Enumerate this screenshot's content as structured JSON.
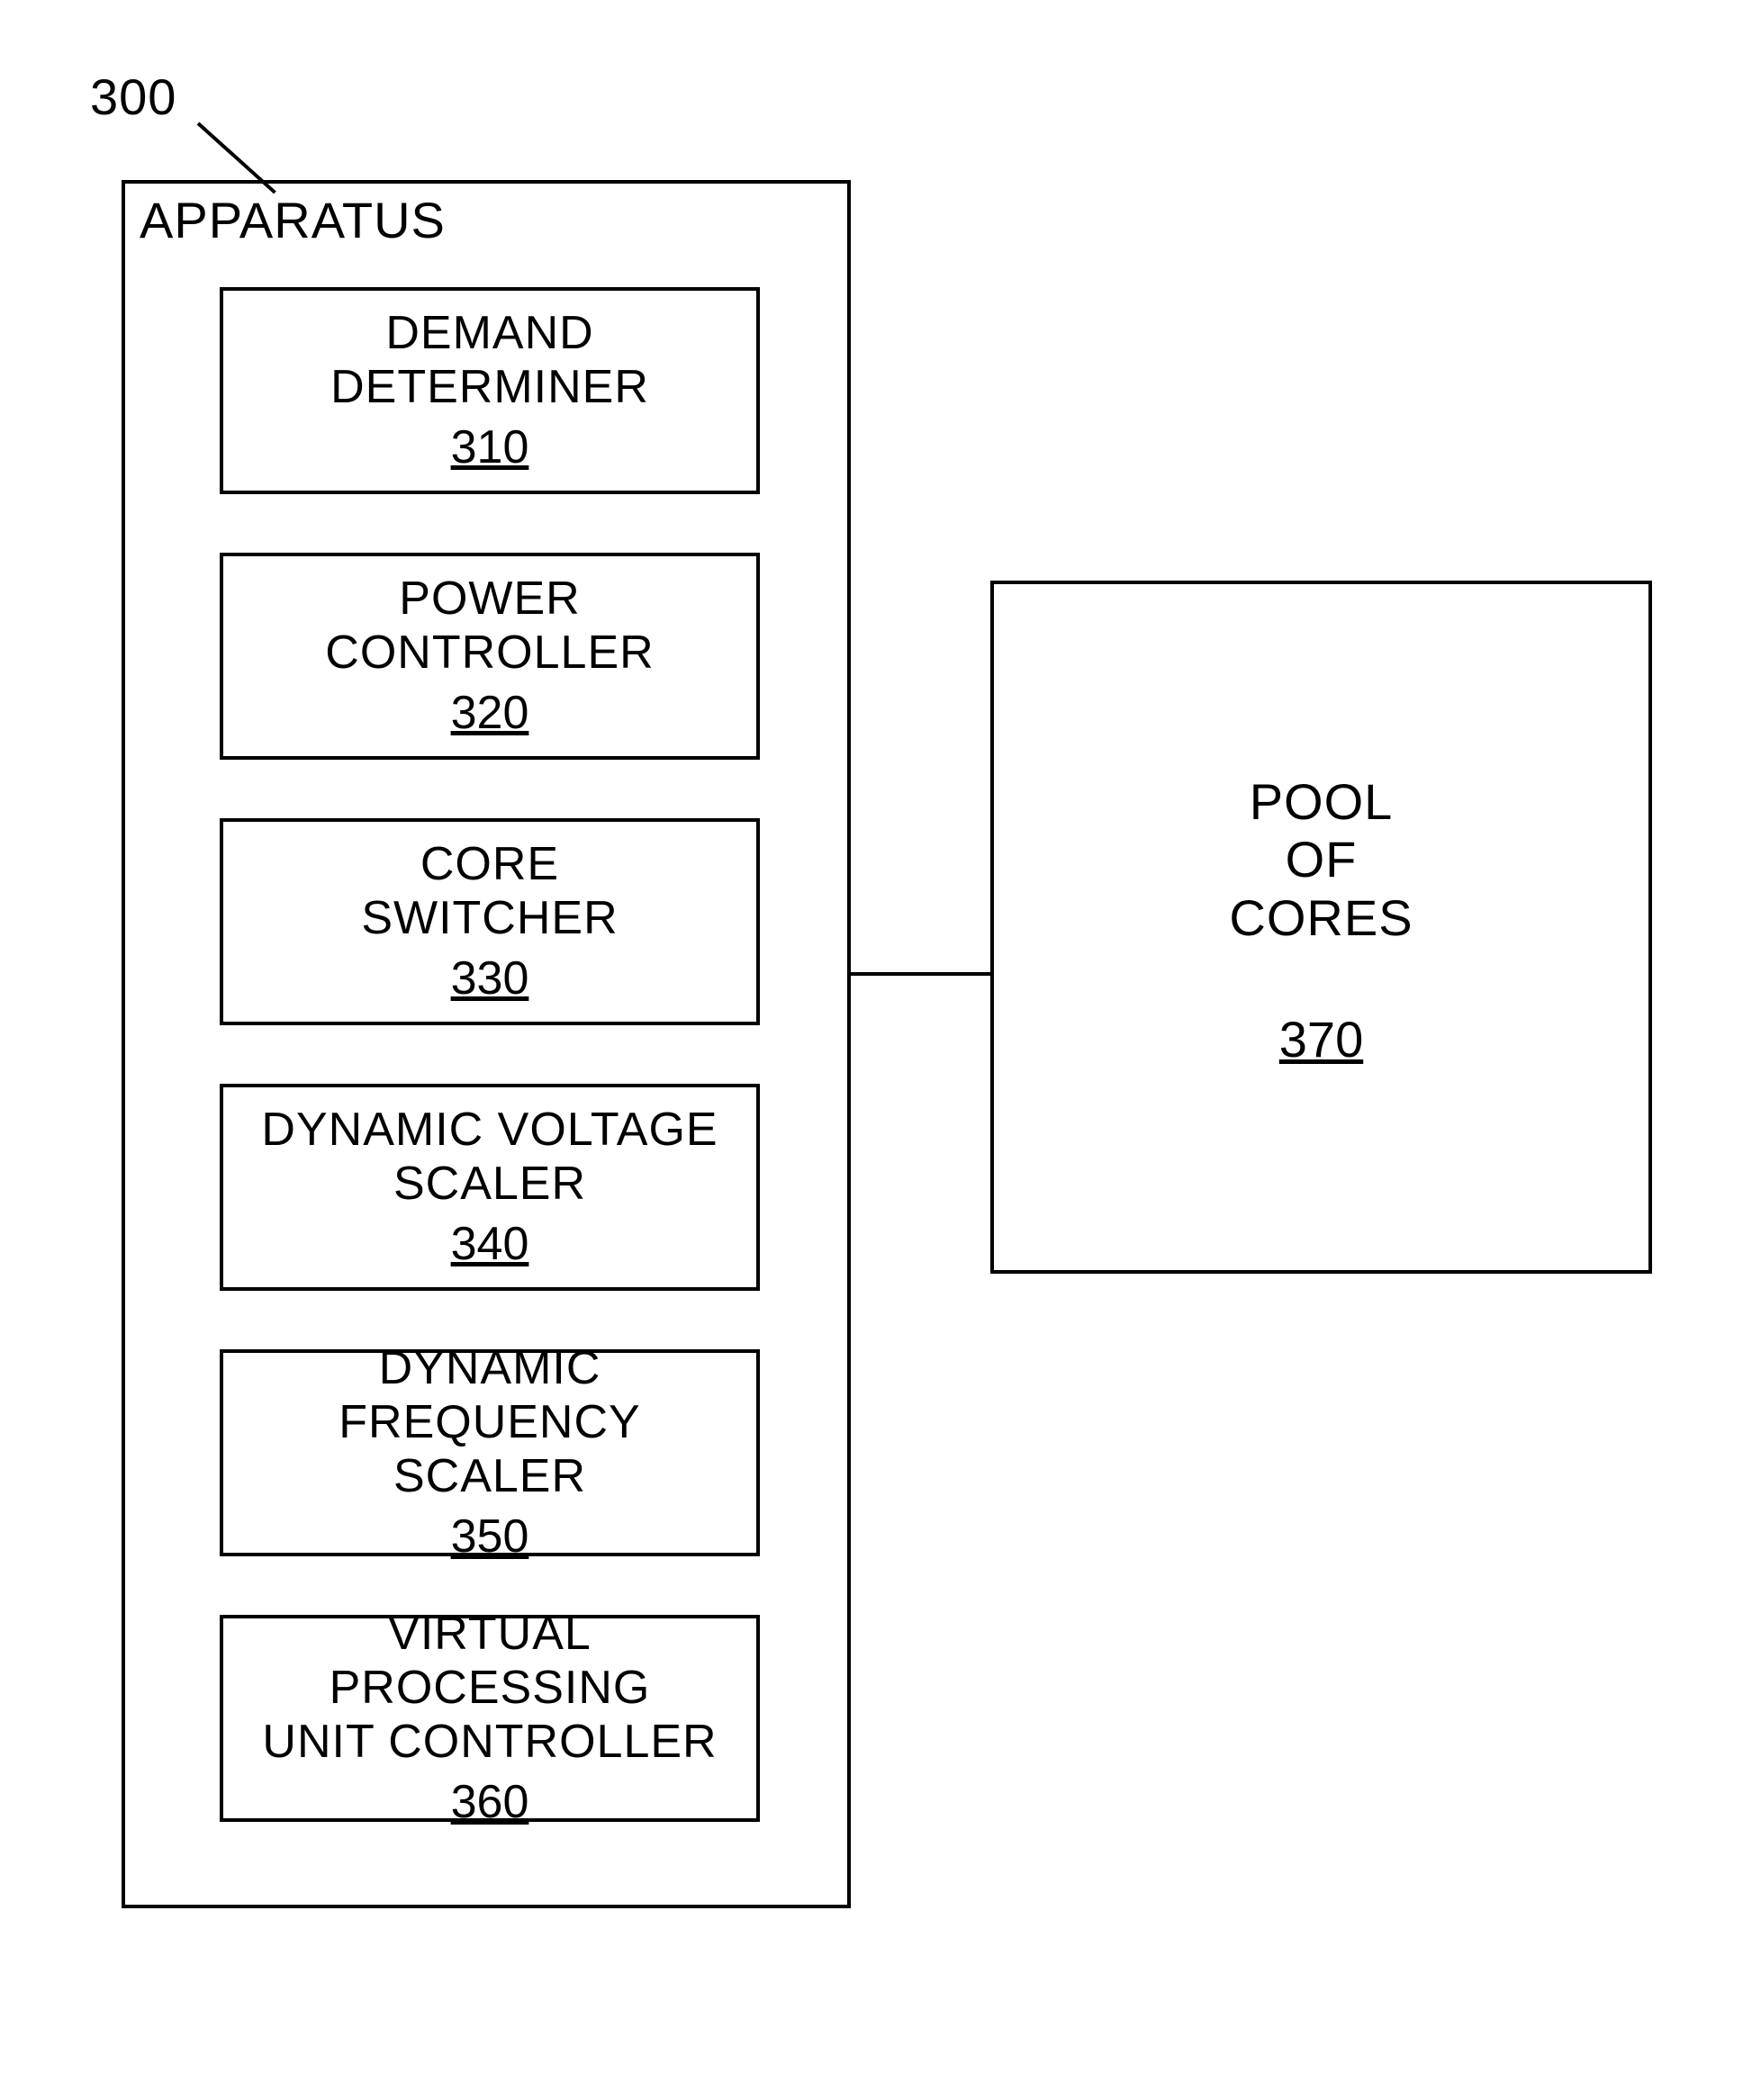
{
  "figure_ref": "300",
  "left_box": {
    "title": "APPARATUS",
    "modules": [
      {
        "lines": [
          "DEMAND",
          "DETERMINER"
        ],
        "num": "310"
      },
      {
        "lines": [
          "POWER",
          "CONTROLLER"
        ],
        "num": "320"
      },
      {
        "lines": [
          "CORE",
          "SWITCHER"
        ],
        "num": "330"
      },
      {
        "lines": [
          "DYNAMIC VOLTAGE",
          "SCALER"
        ],
        "num": "340"
      },
      {
        "lines": [
          "DYNAMIC FREQUENCY",
          "SCALER"
        ],
        "num": "350"
      },
      {
        "lines": [
          "VIRTUAL PROCESSING",
          "UNIT CONTROLLER"
        ],
        "num": "360"
      }
    ]
  },
  "right_box": {
    "lines": [
      "POOL",
      "OF",
      "CORES"
    ],
    "num": "370"
  }
}
